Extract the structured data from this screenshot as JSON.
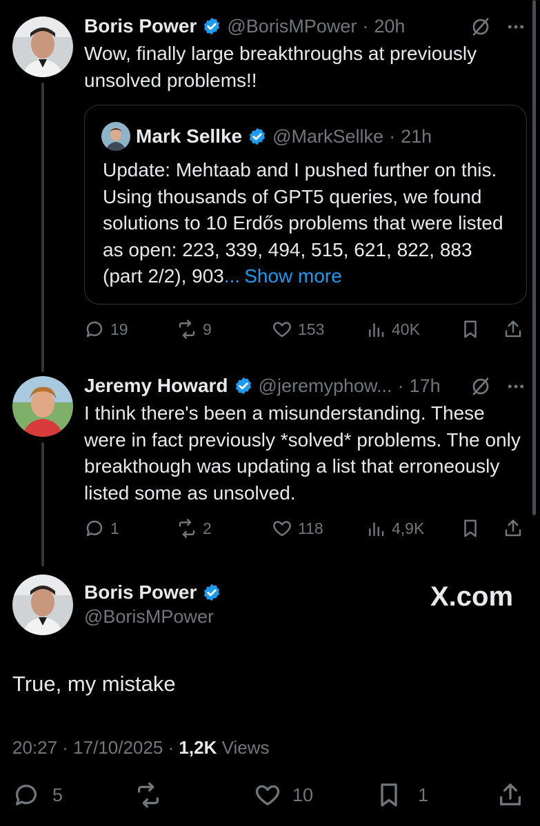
{
  "colors": {
    "background": "#000000",
    "text": "#e7e9ea",
    "muted": "#71767b",
    "accent": "#1d9bf0",
    "border": "#2f3336"
  },
  "post1": {
    "author": "Boris Power",
    "handle": "@BorisMPower",
    "sep": "·",
    "time": "20h",
    "text": "Wow, finally large breakthroughs at previously unsolved problems!!",
    "quote": {
      "author": "Mark Sellke",
      "handle": "@MarkSellke",
      "sep": "·",
      "time": "21h",
      "text": "Update: Mehtaab and I pushed further on this. Using thousands of GPT5 queries, we found solutions to 10 Erdős problems that were listed as open: 223, 339, 494, 515, 621, 822, 883 (part 2/2), 903",
      "ellipsis": "...",
      "show_more": "Show more"
    },
    "stats": {
      "replies": "19",
      "reposts": "9",
      "likes": "153",
      "views": "40K"
    }
  },
  "post2": {
    "author": "Jeremy Howard",
    "handle": "@jeremyphow...",
    "sep": "·",
    "time": "17h",
    "text": "I think there's been a misunderstanding. These were in fact previously *solved* problems. The only breakthough was updating a list that erroneously listed some as unsolved.",
    "stats": {
      "replies": "1",
      "reposts": "2",
      "likes": "118",
      "views": "4,9K"
    }
  },
  "main_post": {
    "author": "Boris Power",
    "handle": "@BorisMPower",
    "watermark": "X.com",
    "text": "True, my mistake",
    "timestamp": "20:27 · 17/10/2025 ·",
    "views_count": "1,2K",
    "views_label": "Views",
    "stats": {
      "replies": "5",
      "likes": "10",
      "bookmarks": "1"
    }
  }
}
